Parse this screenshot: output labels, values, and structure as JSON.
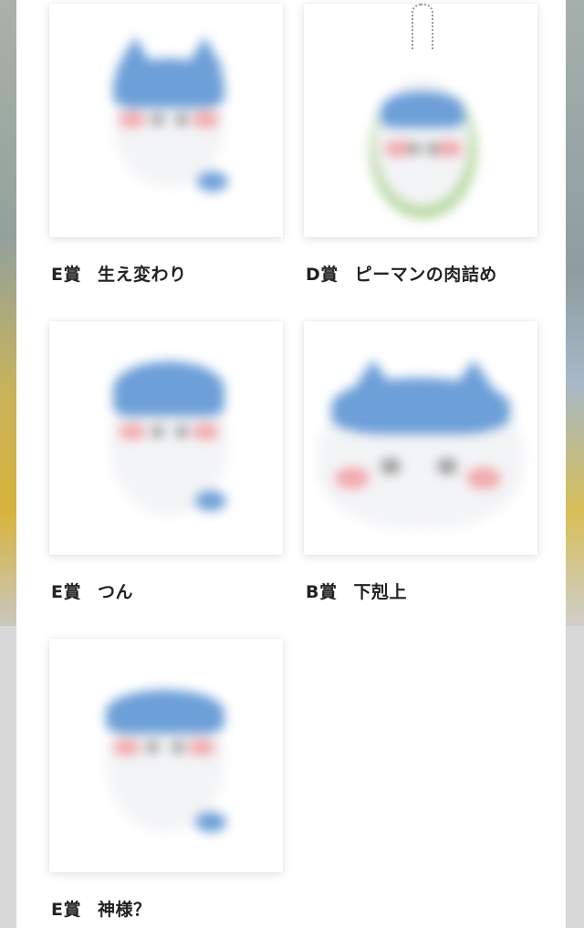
{
  "items": [
    {
      "rank": "E賞",
      "name": "生え変わり",
      "image": "plush-mascot-sitting"
    },
    {
      "rank": "D賞",
      "name": "ピーマンの肉詰め",
      "image": "plush-mascot-keychain-in-pepper"
    },
    {
      "rank": "E賞",
      "name": "つん",
      "image": "plush-mascot-pointed-head"
    },
    {
      "rank": "B賞",
      "name": "下剋上",
      "image": "large-plush-mascot-face"
    },
    {
      "rank": "E賞",
      "name": "神様？",
      "image": "plush-mascot-round"
    }
  ],
  "colors": {
    "mascot_blue": "#6d9fd8",
    "cheek_pink": "#f2a9ae",
    "caption_text": "#222222",
    "sheet_bg": "#ffffff"
  }
}
